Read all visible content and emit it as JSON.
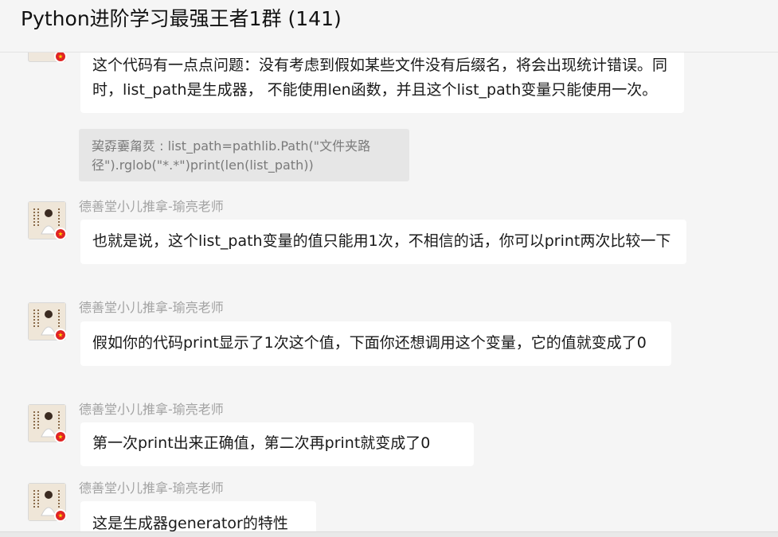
{
  "header": {
    "title": "Python进阶学习最强王者1群 (141)"
  },
  "messages": [
    {
      "text": "这个代码有一点点问题：没有考虑到假如某些文件没有后缀名，将会出现统计错误。同时，list_path是生成器， 不能使用len函数，并且这个list_path变量只能使用一次。"
    },
    {
      "sender": "德善堂小儿推拿-瑜亮老师",
      "text": "也就是说，这个list_path变量的值只能用1次，不相信的话，你可以print两次比较一下"
    },
    {
      "sender": "德善堂小儿推拿-瑜亮老师",
      "text": "假如你的代码print显示了1次这个值，下面你还想调用这个变量，它的值就变成了0"
    },
    {
      "sender": "德善堂小儿推拿-瑜亮老师",
      "text": "第一次print出来正确值，第二次再print就变成了0"
    },
    {
      "sender": "德善堂小儿推拿-瑜亮老师",
      "text": "这是生成器generator的特性"
    }
  ],
  "quote": {
    "text": "巭孬嫑甮烎 : list_path=pathlib.Path(\"文件夹路径\").rglob(\"*.*\")print(len(list_path))"
  },
  "colors": {
    "background": "#f5f5f5",
    "bubble": "#ffffff",
    "quote": "#e6e6e6",
    "sender": "#a3a3a3",
    "badge": "#e02424"
  }
}
